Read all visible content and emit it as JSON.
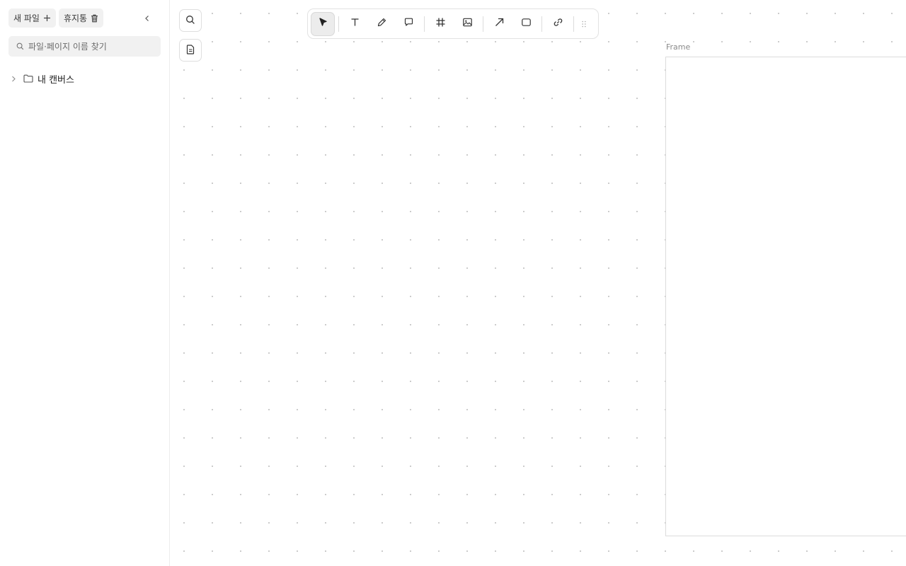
{
  "sidebar": {
    "new_file_label": "새 파일",
    "trash_label": "휴지통",
    "search_placeholder": "파일·페이지 이름 찾기",
    "tree": [
      {
        "label": "내 캔버스",
        "icon": "folder-icon",
        "expanded": false
      }
    ]
  },
  "canvas": {
    "frame_label": "Frame"
  },
  "toolbar": {
    "tools": [
      {
        "name": "select",
        "icon": "cursor-icon",
        "active": true
      },
      {
        "name": "text",
        "icon": "text-icon"
      },
      {
        "name": "pen",
        "icon": "pen-icon"
      },
      {
        "name": "comment",
        "icon": "comment-icon"
      },
      {
        "name": "frame",
        "icon": "hash-frame-icon"
      },
      {
        "name": "image",
        "icon": "image-icon"
      },
      {
        "name": "arrow",
        "icon": "arrow-icon"
      },
      {
        "name": "rectangle",
        "icon": "rectangle-icon"
      },
      {
        "name": "link",
        "icon": "link-icon"
      }
    ]
  },
  "colors": {
    "canvas_dot": "#c4c4c4",
    "active_tool_bg": "#ececec",
    "chip_bg": "#f1f1f1"
  }
}
